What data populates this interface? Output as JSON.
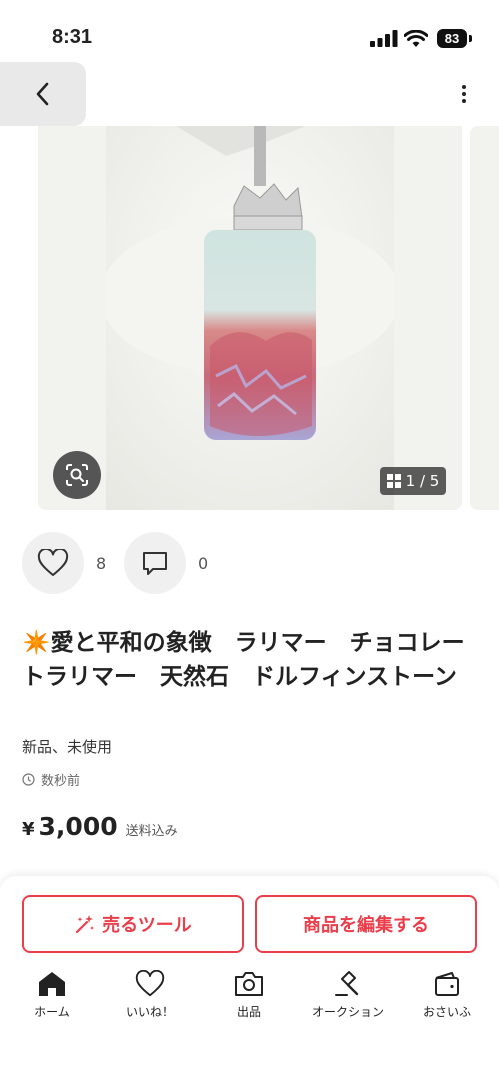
{
  "status_bar": {
    "time": "8:31",
    "battery": "83"
  },
  "gallery": {
    "counter": "1 / 5"
  },
  "actions": {
    "like_count": "8",
    "comment_count": "0"
  },
  "item": {
    "title": "愛と平和の象徴　ラリマー　チョコレートラリマー　天然石　ドルフィンストーン",
    "title_emoji": "✴️",
    "condition": "新品、未使用",
    "posted": "数秒前",
    "price_symbol": "¥",
    "price": "3,000",
    "shipping": "送料込み"
  },
  "buttons": {
    "sell_tool": "売るツール",
    "edit_item": "商品を編集する"
  },
  "nav": {
    "home": "ホーム",
    "likes": "いいね！",
    "sell": "出品",
    "auction": "オークション",
    "wallet": "おさいふ"
  },
  "colors": {
    "accent": "#ea3f4b"
  }
}
